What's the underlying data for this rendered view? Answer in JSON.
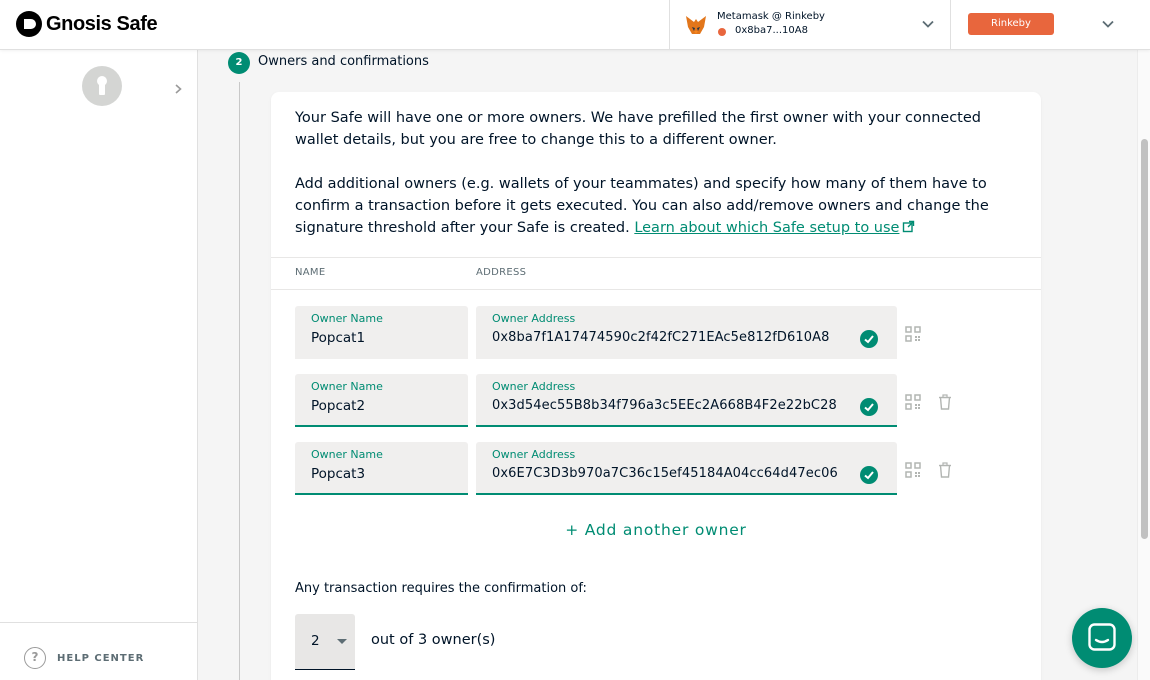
{
  "header": {
    "logo_text": "Gnosis Safe",
    "wallet_title": "Metamask @ Rinkeby",
    "wallet_address": "0x8ba7...10A8",
    "network_badge": "Rinkeby",
    "colors": {
      "network": "#e8663d",
      "accent": "#008c73"
    }
  },
  "sidebar": {
    "help_center": "HELP CENTER"
  },
  "step": {
    "number": "2",
    "title": "Owners and confirmations"
  },
  "intro": {
    "paragraph_1": "Your Safe will have one or more owners. We have prefilled the first owner with your connected wallet details, but you are free to change this to a different owner.",
    "paragraph_2": "Add additional owners (e.g. wallets of your teammates) and specify how many of them have to confirm a transaction before it gets executed. You can also add/remove owners and change the signature threshold after your Safe is created.",
    "link_text": "Learn about which Safe setup to use"
  },
  "columns": {
    "name": "NAME",
    "address": "ADDRESS"
  },
  "owners": [
    {
      "name_label": "Owner Name",
      "name": "Popcat1",
      "address_label": "Owner Address",
      "address": "0x8ba7f1A17474590c2f42fC271EAc5e812fD610A8"
    },
    {
      "name_label": "Owner Name",
      "name": "Popcat2",
      "address_label": "Owner Address",
      "address": "0x3d54ec55B8b34f796a3c5EEc2A668B4F2e22bC28"
    },
    {
      "name_label": "Owner Name",
      "name": "Popcat3",
      "address_label": "Owner Address",
      "address": "0x6E7C3D3b970a7C36c15ef45184A04cc64d47ec06"
    }
  ],
  "add_owner_label": "+ Add another owner",
  "threshold": {
    "prompt": "Any transaction requires the confirmation of:",
    "selected": "2",
    "suffix": "out of 3 owner(s)"
  },
  "icons": {
    "header": [
      "fox-icon",
      "chevron-down-icon"
    ],
    "sidebar": [
      "keyhole-icon",
      "chevron-right-icon",
      "help-icon"
    ],
    "owner_row": [
      "check-icon",
      "qr-code-icon",
      "trash-icon"
    ],
    "chat": "chat-icon"
  }
}
